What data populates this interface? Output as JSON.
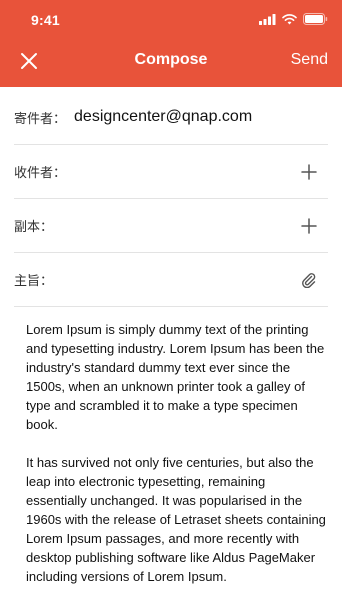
{
  "status_bar": {
    "time": "9:41"
  },
  "nav": {
    "title": "Compose",
    "send_label": "Send"
  },
  "form": {
    "sender_label": "寄件者：",
    "sender_value": "designcenter@qnap.com",
    "to_label": "收件者：",
    "cc_label": "副本：",
    "subject_label": "主旨："
  },
  "body": {
    "paragraph_1": "Lorem Ipsum is simply dummy text of the printing and typesetting industry. Lorem Ipsum has been the industry's standard dummy text ever since the 1500s, when an unknown printer took a galley of type and scrambled it to make a type specimen book.",
    "paragraph_2": "It has survived not only five centuries, but also the leap into electronic typesetting, remaining essentially unchanged. It was popularised in the 1960s with the release of Letraset sheets containing Lorem Ipsum passages, and more recently with desktop publishing software like Aldus PageMaker including versions of Lorem Ipsum."
  },
  "colors": {
    "accent": "#e8533a",
    "divider": "#e3e3e3"
  },
  "icons": [
    "signal-icon",
    "wifi-icon",
    "battery-icon",
    "close-icon",
    "add-recipient-icon",
    "add-cc-icon",
    "attachment-icon"
  ]
}
